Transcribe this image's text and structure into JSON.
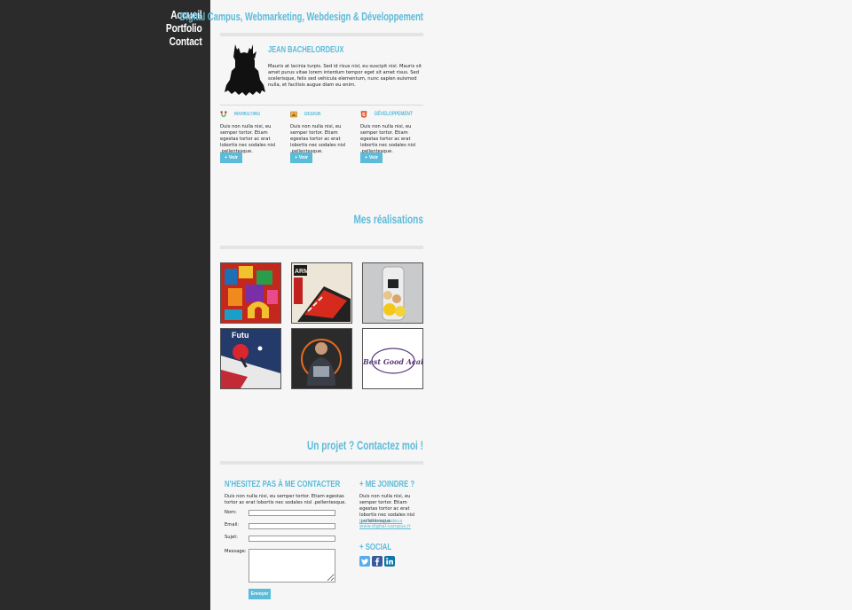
{
  "nav": {
    "items": [
      "Accueil",
      "Portfolio",
      "Contact"
    ]
  },
  "header": {
    "title": "Digital Campus, Webmarketing, Webdesign & Développement"
  },
  "profile": {
    "name": "JEAN BACHELORDEUX",
    "text": "Mauris at lacinia turpis. Sed id risus nisl, eu suscipit nisl. Mauris sit amet purus vitae lorem interdum tempor eget sit amet risus. Sed scelerisque, felis sed vehicula elementum, nunc sapien euismod nulla, et facilisis augue diam eu enim."
  },
  "services": [
    {
      "title": "MARKETING",
      "text": "Duis non nulla nisi, eu semper tortor. Etiam egestas tortor ac erat lobortis nec sodales nisl .pellentesque.",
      "button": "+ Voir",
      "icon": "marketing-icon"
    },
    {
      "title": "DESIGN",
      "text": "Duis non nulla nisi, eu semper tortor. Etiam egestas tortor ac erat lobortis nec sodales nisl .pellentesque.",
      "button": "+ Voir",
      "icon": "design-icon"
    },
    {
      "title": "DÉVELOPPEMENT",
      "text": "Duis non nulla nisi, eu semper tortor. Etiam egestas tortor ac erat lobortis nec sodales nisl .pellentesque.",
      "button": "+ Voir",
      "icon": "html5-icon"
    }
  ],
  "realisations": {
    "title": "Mes réalisations",
    "tiles": [
      {
        "label": ""
      },
      {
        "label": "ARMY"
      },
      {
        "label": ""
      },
      {
        "label": "Futu"
      },
      {
        "label": ""
      },
      {
        "label": "Best Good Acai"
      }
    ]
  },
  "contact": {
    "title": "Un projet ? Contactez moi !",
    "form_title": "N'HESITEZ PAS À ME CONTACTER",
    "intro": "Duis non nulla nisi, eu semper tortor. Etiam egestas tortor ac erat lobortis nec sodales nisl .pellentesque.",
    "labels": {
      "name": "Nom:",
      "email": "Email:",
      "subject": "Sujet:",
      "message": "Message:"
    },
    "send": "Envoyer"
  },
  "join": {
    "title": "+ ME JOINDRE ?",
    "text": "Duis non nulla nisi, eu semper tortor. Etiam egestas tortor ac erat lobortis nec sodales nisl .pellentesque.",
    "name_link": "Jean Bachelordeux",
    "site_link": "www.digital-campus.fr"
  },
  "social": {
    "title": "+ SOCIAL",
    "icons": [
      "twitter-icon",
      "facebook-icon",
      "linkedin-icon"
    ]
  },
  "colors": {
    "accent": "#5bbbd9",
    "sidebar": "#2b2b2b",
    "background": "#f6f6f6"
  }
}
